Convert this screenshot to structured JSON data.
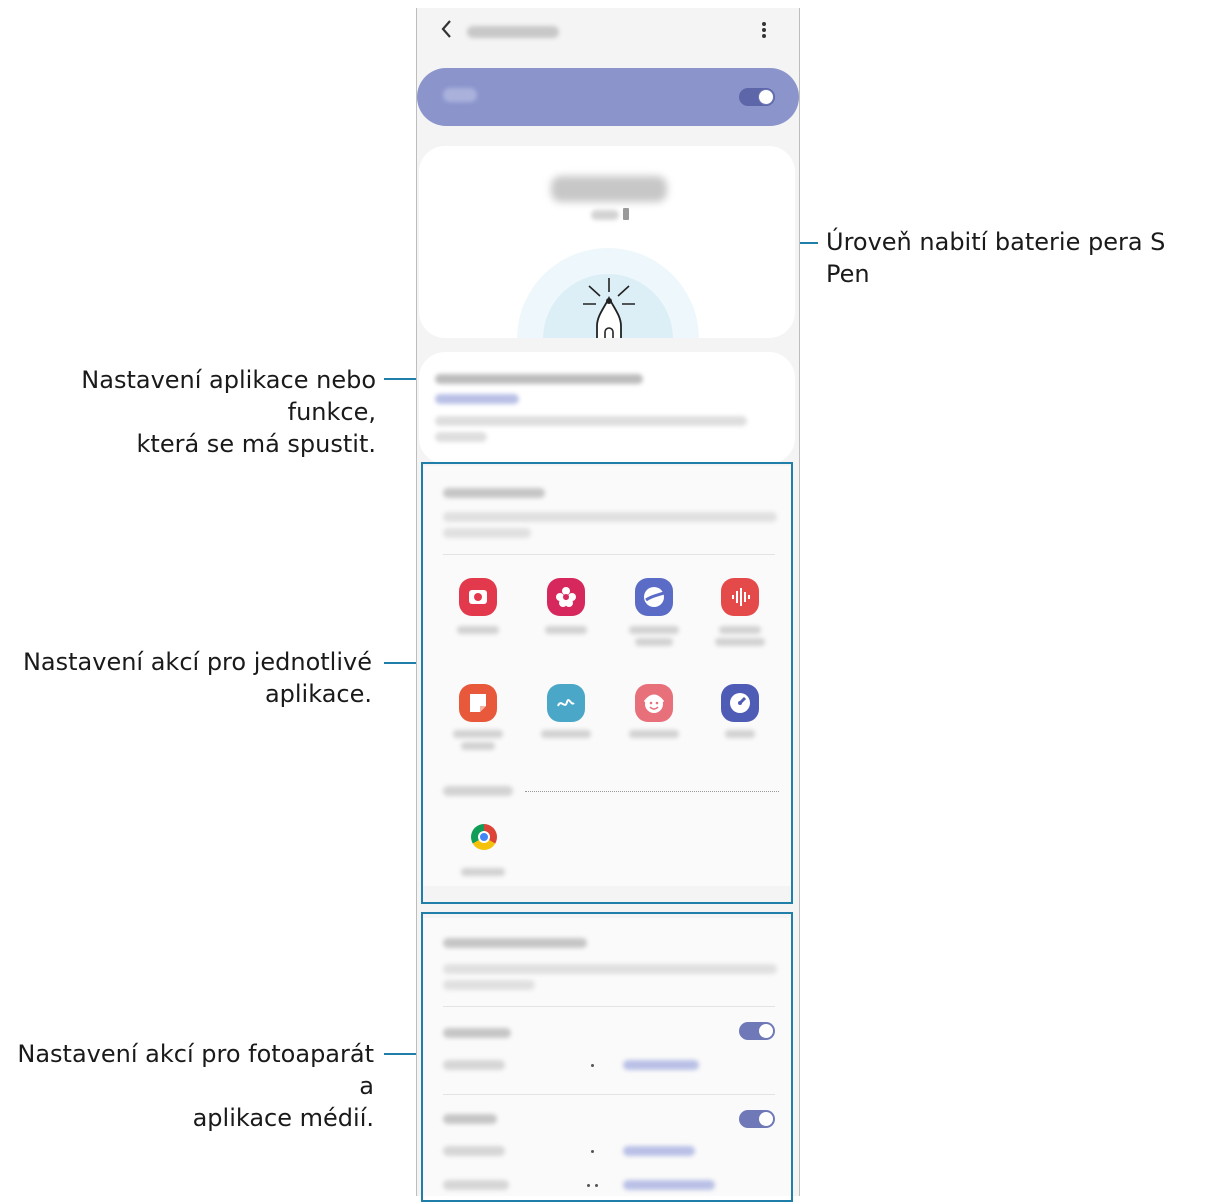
{
  "callouts": {
    "battery": "Úroveň nabití baterie pera S Pen",
    "shortcut": [
      "Nastavení aplikace nebo funkce,",
      "která se má spustit."
    ],
    "app_actions": [
      "Nastavení akcí pro jednotlivé",
      "aplikace."
    ],
    "general": [
      "Nastavení akcí pro fotoaparát a",
      "aplikace médií."
    ]
  },
  "phone": {
    "back_icon": "chevron-left-icon",
    "more_icon": "more-vertical-icon",
    "toggles": {
      "master": true,
      "camera": true,
      "media": true
    }
  },
  "apps": {
    "row1": [
      {
        "icon": "camera-icon",
        "color": "#e23a4c"
      },
      {
        "icon": "gallery-icon",
        "color": "#d6285c"
      },
      {
        "icon": "internet-icon",
        "color": "#5b6cc6"
      },
      {
        "icon": "voice-recorder-icon",
        "color": "#e54a4a"
      }
    ],
    "row2": [
      {
        "icon": "notes-icon",
        "color": "#e8583a"
      },
      {
        "icon": "ar-doodle-icon",
        "color": "#4aa7c7"
      },
      {
        "icon": "ar-emoji-icon",
        "color": "#e8707a"
      },
      {
        "icon": "clock-icon",
        "color": "#4f5cb6"
      }
    ],
    "extra": [
      {
        "icon": "chrome-icon"
      }
    ]
  }
}
